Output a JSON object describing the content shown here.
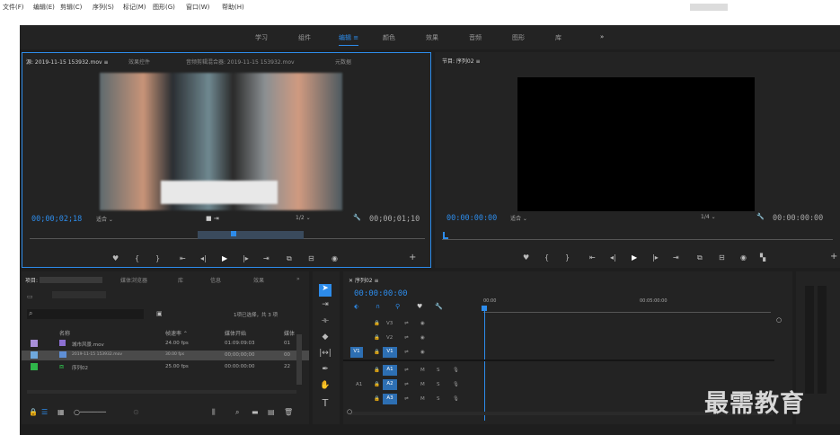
{
  "menu": [
    "文件(F)",
    "编辑(E)",
    "剪辑(C)",
    "序列(S)",
    "标记(M)",
    "图形(G)",
    "窗口(W)",
    "帮助(H)"
  ],
  "workspaces": {
    "items": [
      "学习",
      "组件",
      "编辑",
      "颜色",
      "效果",
      "音频",
      "图形",
      "库"
    ],
    "active_index": 2,
    "more": "»"
  },
  "source": {
    "tabs": [
      "源: 2019-11-15 153932.mov",
      "效果控件",
      "音频剪辑混合器: 2019-11-15 153932.mov",
      "元数据"
    ],
    "timecode_in": "00;00;02;18",
    "fit": "适合",
    "scale": "1/2",
    "timecode_out": "00;00;01;10"
  },
  "program": {
    "tab": "节目: 序列02",
    "timecode_in": "00:00:00:00",
    "fit": "适合",
    "scale": "1/4",
    "timecode_out": "00:00:00:00"
  },
  "project": {
    "tabs": [
      "项目:",
      "媒体浏览器",
      "库",
      "信息",
      "效果",
      "»"
    ],
    "status": "1项已选择，共 3 项",
    "headers": [
      "名称",
      "帧速率",
      "媒体开始",
      "媒体"
    ],
    "rows": [
      {
        "swatch": "#a88fd8",
        "name": "城市风景.mov",
        "fps": "24.00 fps",
        "start": "01:09:09:03",
        "end": "01"
      },
      {
        "swatch": "#6fa8dc",
        "name": "2019-11-15 153932.mov",
        "fps": "30.00 fps",
        "start": "00;00;00;00",
        "end": "00"
      },
      {
        "swatch": "#2fb64a",
        "name": "序列02",
        "fps": "25.00 fps",
        "start": "00:00:00:00",
        "end": "22"
      }
    ]
  },
  "timeline": {
    "tab": "序列02",
    "timecode": "00:00:00:00",
    "ruler_start": "00:00",
    "ruler_mid": "00:05:00:00",
    "video_tracks": [
      "V3",
      "V2",
      "V1"
    ],
    "audio_tracks": [
      "A1",
      "A2",
      "A3"
    ],
    "target_v": "V1",
    "target_a": "A1",
    "solo": "S",
    "mute": "M"
  },
  "watermark": "最需教育",
  "colors": {
    "accent": "#2d8ceb",
    "panel": "#232323",
    "bg": "#1e1e1e"
  }
}
